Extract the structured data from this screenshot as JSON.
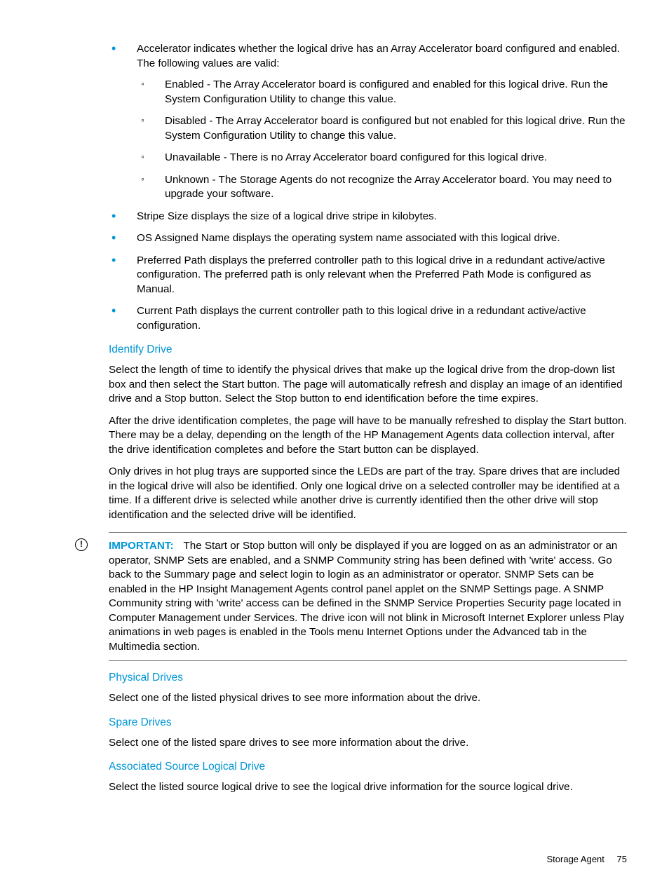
{
  "bullets_l1": [
    {
      "text": "Accelerator indicates whether the logical drive has an Array Accelerator board configured and enabled. The following values are valid:",
      "sub": [
        "Enabled - The Array Accelerator board is configured and enabled for this logical drive. Run the System Configuration Utility to change this value.",
        "Disabled - The Array Accelerator board is configured but not enabled for this logical drive. Run the System Configuration Utility to change this value.",
        "Unavailable - There is no Array Accelerator board configured for this logical drive.",
        "Unknown - The Storage Agents do not recognize the Array Accelerator board. You may need to upgrade your software."
      ]
    },
    {
      "text": "Stripe Size displays the size of a logical drive stripe in kilobytes."
    },
    {
      "text": "OS Assigned Name displays the operating system name associated with this logical drive."
    },
    {
      "text": "Preferred Path displays the preferred controller path to this logical drive in a redundant active/active configuration. The preferred path is only relevant when the Preferred Path Mode is configured as Manual."
    },
    {
      "text": "Current Path displays the current controller path to this logical drive in a redundant active/active configuration."
    }
  ],
  "sections": {
    "identify": {
      "heading": "Identify Drive",
      "p1": "Select the length of time to identify the physical drives that make up the logical drive from the drop-down list box and then select the Start button. The page will automatically refresh and display an image of an identified drive and a Stop button. Select the Stop button to end identification before the time expires.",
      "p2": "After the drive identification completes, the page will have to be manually refreshed to display the Start button. There may be a delay, depending on the length of the HP Management Agents data collection interval, after the drive identification completes and before the Start button can be displayed.",
      "p3": "Only drives in hot plug trays are supported since the LEDs are part of the tray. Spare drives that are included in the logical drive will also be identified. Only one logical drive on a selected controller may be identified at a time. If a different drive is selected while another drive is currently identified then the other drive will stop identification and the selected drive will be identified."
    },
    "important": {
      "label": "IMPORTANT:",
      "text": "The Start or Stop button will only be displayed if you are logged on as an administrator or an operator, SNMP Sets are enabled, and a SNMP Community string has been defined with 'write' access. Go back to the Summary page and select login to login as an administrator or operator. SNMP Sets can be enabled in the HP Insight Management Agents control panel applet on the SNMP Settings page. A SNMP Community string with 'write' access can be defined in the SNMP Service Properties Security page located in Computer Management under Services. The drive icon will not blink in Microsoft Internet Explorer unless Play animations in web pages is enabled in the Tools menu Internet Options under the Advanced tab in the Multimedia section."
    },
    "physical": {
      "heading": "Physical Drives",
      "p1": "Select one of the listed physical drives to see more information about the drive."
    },
    "spare": {
      "heading": "Spare Drives",
      "p1": "Select one of the listed spare drives to see more information about the drive."
    },
    "assoc": {
      "heading": "Associated Source Logical Drive",
      "p1": "Select the listed source logical drive to see the logical drive information for the source logical drive."
    }
  },
  "footer": {
    "section": "Storage Agent",
    "page": "75"
  },
  "icon_glyph": "!"
}
